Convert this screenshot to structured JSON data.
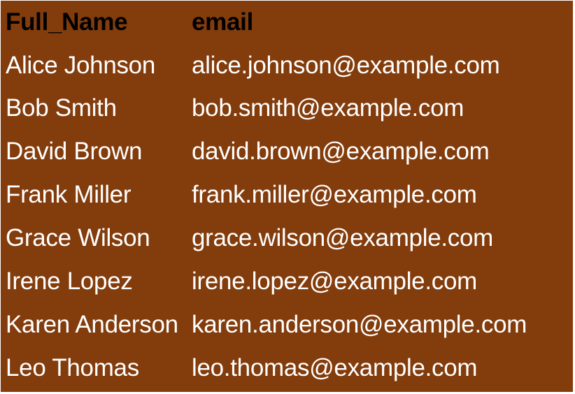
{
  "colors": {
    "background": "#833c0c",
    "text": "#ffffff",
    "header_text": "#000000"
  },
  "table": {
    "columns": [
      "Full_Name",
      "email"
    ],
    "rows": [
      [
        "Alice Johnson",
        "alice.johnson@example.com"
      ],
      [
        "Bob Smith",
        "bob.smith@example.com"
      ],
      [
        "David Brown",
        "david.brown@example.com"
      ],
      [
        "Frank Miller",
        "frank.miller@example.com"
      ],
      [
        "Grace Wilson",
        "grace.wilson@example.com"
      ],
      [
        "Irene Lopez",
        "irene.lopez@example.com"
      ],
      [
        "Karen Anderson",
        "karen.anderson@example.com"
      ],
      [
        "Leo Thomas",
        "leo.thomas@example.com"
      ]
    ]
  }
}
